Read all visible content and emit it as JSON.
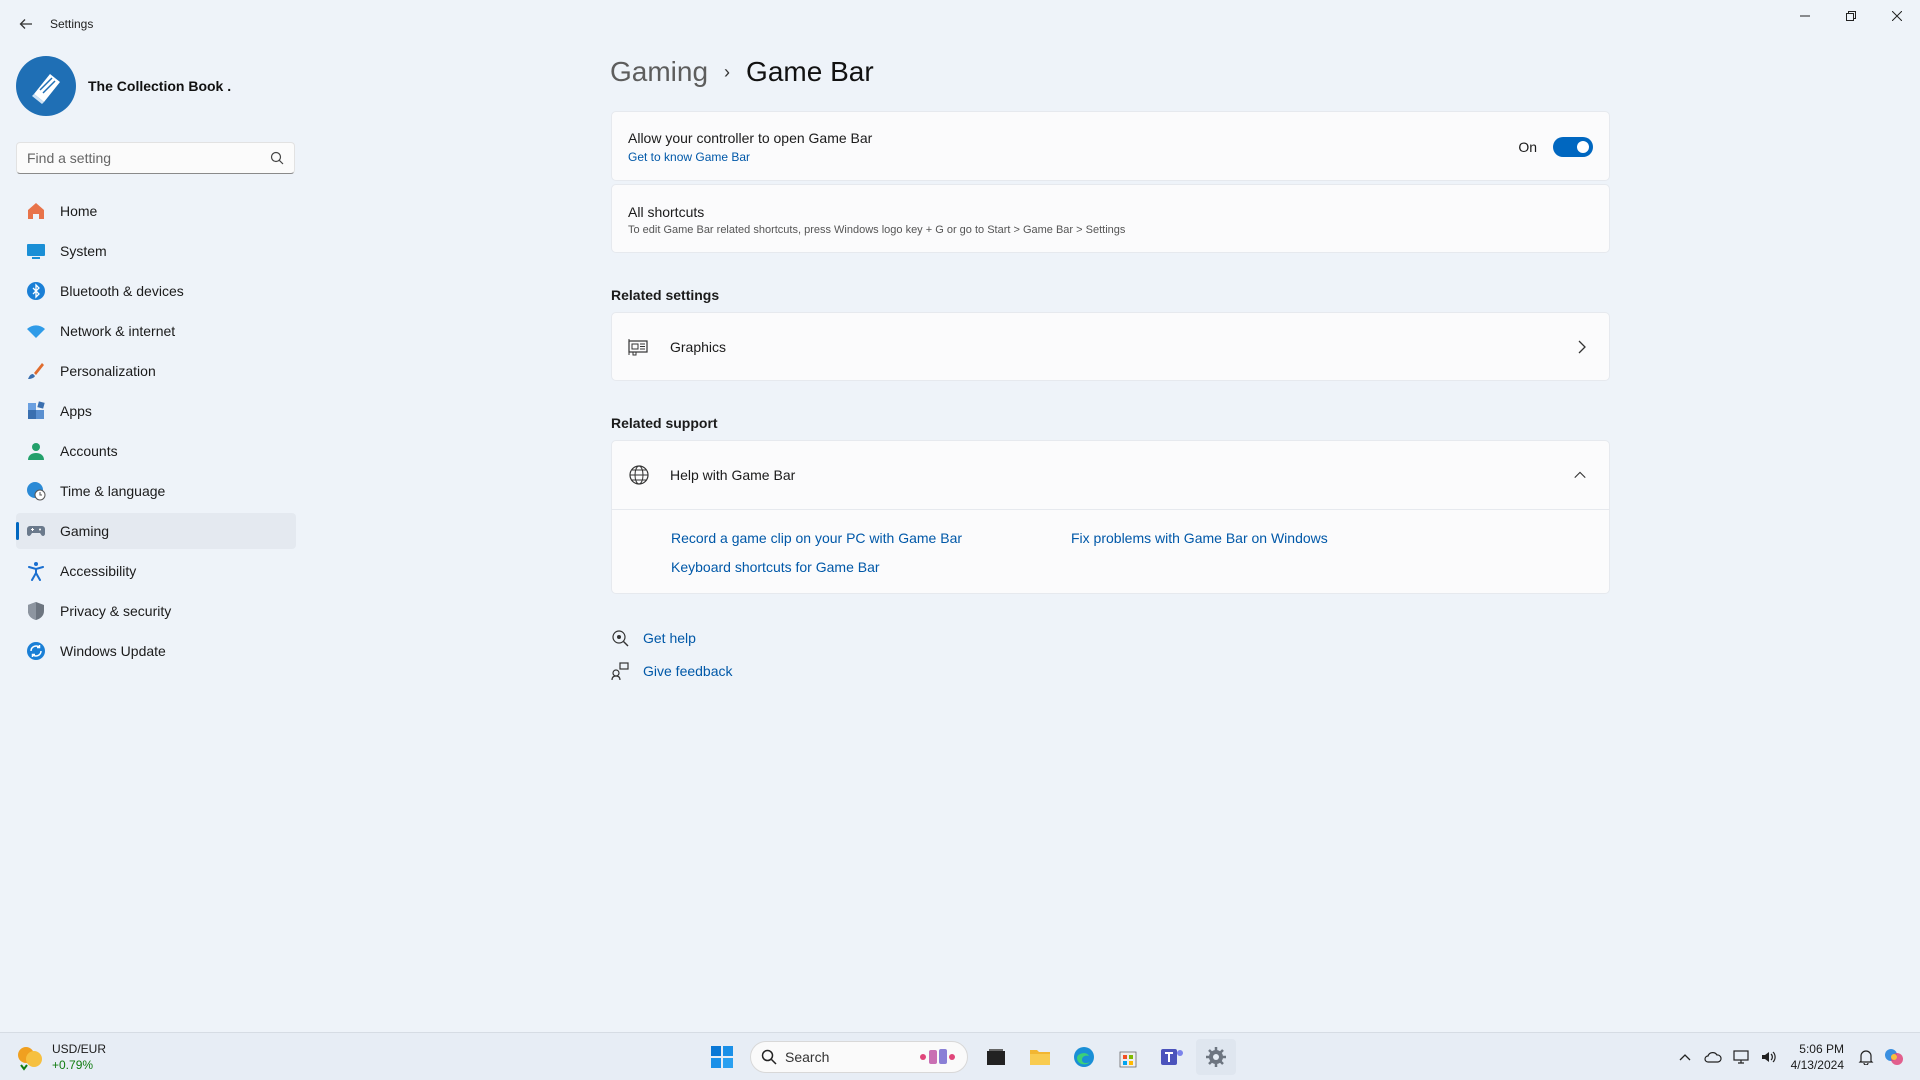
{
  "window": {
    "title": "Settings",
    "controls": [
      "minimize",
      "maximize",
      "close"
    ]
  },
  "profile": {
    "name": "The Collection Book ."
  },
  "search": {
    "placeholder": "Find a setting"
  },
  "nav": {
    "items": [
      {
        "label": "Home",
        "icon": "home-icon",
        "color": "#e8734a"
      },
      {
        "label": "System",
        "icon": "monitor-icon",
        "color": "#1a8fd6"
      },
      {
        "label": "Bluetooth & devices",
        "icon": "bluetooth-icon",
        "color": "#1a7fd6"
      },
      {
        "label": "Network & internet",
        "icon": "wifi-icon",
        "color": "#2f9be8"
      },
      {
        "label": "Personalization",
        "icon": "brush-icon",
        "color": "#e06c2e"
      },
      {
        "label": "Apps",
        "icon": "apps-icon",
        "color": "#3a6fb0"
      },
      {
        "label": "Accounts",
        "icon": "person-icon",
        "color": "#22a06b"
      },
      {
        "label": "Time & language",
        "icon": "globe-clock-icon",
        "color": "#2b8ad6"
      },
      {
        "label": "Gaming",
        "icon": "gamepad-icon",
        "color": "#6b7a8c",
        "active": true
      },
      {
        "label": "Accessibility",
        "icon": "accessibility-icon",
        "color": "#1a6fd0"
      },
      {
        "label": "Privacy & security",
        "icon": "shield-icon",
        "color": "#6d7580"
      },
      {
        "label": "Windows Update",
        "icon": "update-icon",
        "color": "#1a7fd6"
      }
    ]
  },
  "breadcrumb": {
    "parent": "Gaming",
    "current": "Game Bar"
  },
  "controller_card": {
    "title": "Allow your controller to open Game Bar",
    "link": "Get to know Game Bar",
    "toggle_label": "On",
    "toggle_on": true
  },
  "shortcuts_card": {
    "title": "All shortcuts",
    "description": "To edit Game Bar related shortcuts, press Windows logo key + G or go to Start > Game Bar > Settings"
  },
  "related_settings": {
    "title": "Related settings",
    "graphics_label": "Graphics"
  },
  "related_support": {
    "title": "Related support",
    "help_label": "Help with Game Bar",
    "links": [
      "Record a game clip on your PC with Game Bar",
      "Fix problems with Game Bar on Windows",
      "Keyboard shortcuts for Game Bar"
    ]
  },
  "footer": {
    "get_help": "Get help",
    "give_feedback": "Give feedback"
  },
  "taskbar": {
    "widget_title": "USD/EUR",
    "widget_change": "+0.79%",
    "search_label": "Search",
    "time": "5:06 PM",
    "date": "4/13/2024"
  },
  "colors": {
    "accent": "#0067c0",
    "link": "#0058a8",
    "background": "#eef3f9"
  }
}
